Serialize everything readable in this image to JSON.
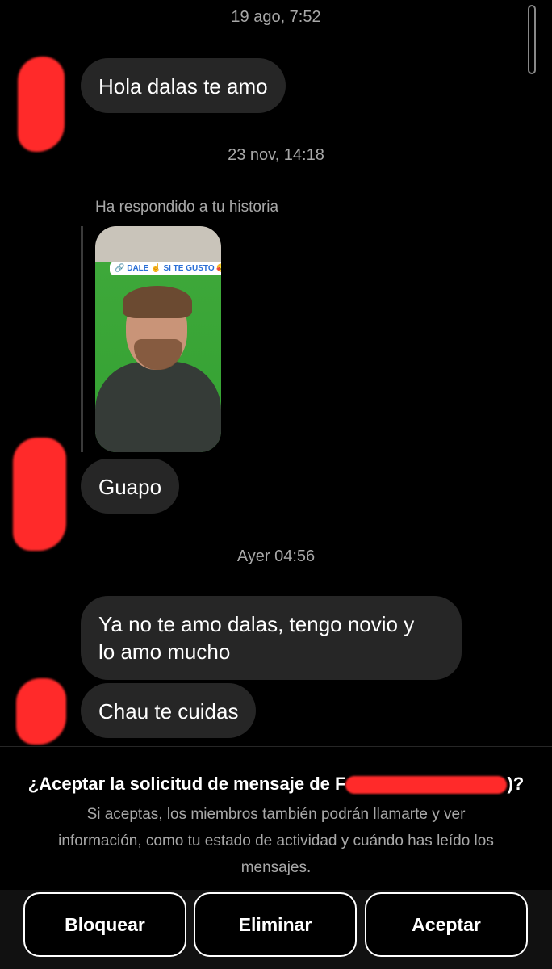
{
  "timestamps": [
    "19 ago, 7:52",
    "23 nov, 14:18",
    "Ayer 04:56"
  ],
  "messages": {
    "m1": "Hola dalas te amo",
    "reply_label": "Ha respondido a tu historia",
    "story_sticker": "🔗 DALE ☝ SI TE GUSTO 🥰",
    "m2": "Guapo",
    "m3_line1": "Ya no te amo dalas, tengo novio y",
    "m3_line2": "lo amo mucho",
    "m4": "Chau te cuidas"
  },
  "request": {
    "title_prefix": "¿Aceptar la solicitud de mensaje de F",
    "title_suffix": ")?",
    "description_line1": "Si aceptas, los miembros también podrán llamarte y ver",
    "description_line2": "información, como tu estado de actividad y cuándo has leído los",
    "description_line3": "mensajes."
  },
  "buttons": {
    "block": "Bloquear",
    "delete": "Eliminar",
    "accept": "Aceptar"
  },
  "colors": {
    "background": "#000000",
    "bubble": "#262626",
    "secondary_text": "#a8a8a8",
    "redaction": "#ff2a2a"
  }
}
